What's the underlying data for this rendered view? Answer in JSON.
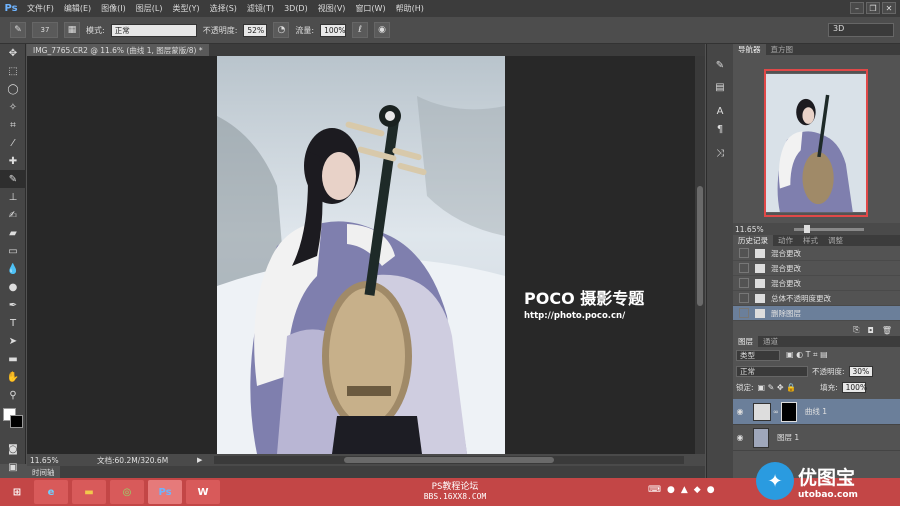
{
  "app": {
    "logo": "Ps"
  },
  "menu": [
    "文件(F)",
    "编辑(E)",
    "图像(I)",
    "图层(L)",
    "类型(Y)",
    "选择(S)",
    "滤镜(T)",
    "3D(D)",
    "视图(V)",
    "窗口(W)",
    "帮助(H)"
  ],
  "options": {
    "brush_size": "37",
    "mode_label": "模式:",
    "mode_value": "正常",
    "opacity_label": "不透明度:",
    "opacity_value": "52%",
    "flow_label": "流量:",
    "flow_value": "100%",
    "workspace": "3D"
  },
  "document": {
    "tab_title": "IMG_7765.CR2 @ 11.6% (曲线 1, 图层蒙版/8) *",
    "zoom": "11.65%",
    "doc_size": "文档:60.2M/320.6M",
    "timeline": "时间轴"
  },
  "watermark": {
    "brand": "POCO 摄影专题",
    "url": "http://photo.poco.cn/"
  },
  "navigator": {
    "tabs": [
      "导航器",
      "直方图"
    ],
    "zoom": "11.65%"
  },
  "history": {
    "tabs": [
      "历史记录",
      "动作",
      "样式",
      "调整"
    ],
    "items": [
      "混合更改",
      "混合更改",
      "混合更改",
      "总体不透明度更改",
      "删除图层"
    ]
  },
  "layers": {
    "tabs": [
      "图层",
      "通道"
    ],
    "filter_kind": "类型",
    "blend_mode": "正常",
    "opacity_label": "不透明度:",
    "opacity_value": "30%",
    "lock_label": "锁定:",
    "fill_label": "填充:",
    "fill_value": "100%",
    "items": [
      "曲线 1",
      "图层 1"
    ]
  },
  "taskbar": {
    "center_line1": "PS教程论坛",
    "center_line2": "BBS.16XX8.COM",
    "brand_name": "优图宝",
    "brand_url": "utobao.com"
  },
  "colors": {
    "taskbar": "#c34646",
    "accent": "#6fb4ff"
  }
}
